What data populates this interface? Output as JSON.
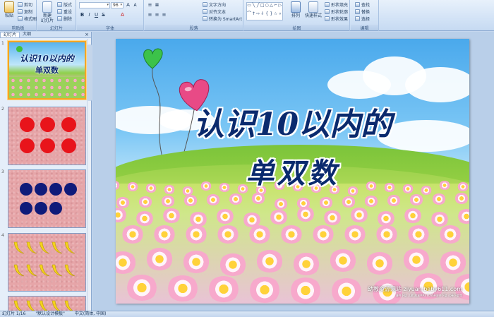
{
  "ribbon": {
    "clipboard": {
      "paste": "粘贴",
      "cut": "剪切",
      "copy": "复制",
      "format_painter": "格式刷",
      "label": "剪贴板"
    },
    "slides": {
      "new_slide": "新建\n幻灯片",
      "layout": "版式",
      "reset": "重设",
      "delete": "删除",
      "label": "幻灯片"
    },
    "font": {
      "font_value": "",
      "size_value": "96",
      "label": "字体"
    },
    "paragraph": {
      "text_direction": "文字方向",
      "align_text": "对齐文本",
      "smartart": "转换为 SmartArt",
      "label": "段落"
    },
    "drawing": {
      "arrange": "排列",
      "quick_styles": "快速样式",
      "fill": "形状填充",
      "outline": "形状轮廓",
      "effects": "形状效果",
      "label": "绘图"
    },
    "editing": {
      "find": "查找",
      "replace": "替换",
      "select": "选择",
      "label": "编辑"
    }
  },
  "left_pane": {
    "tabs": [
      "幻灯片",
      "大纲"
    ],
    "close_glyph": "×",
    "slides": [
      {
        "number": "1",
        "title_line1": "认识10以内的",
        "title_line2": "单双数"
      },
      {
        "number": "2"
      },
      {
        "number": "3"
      },
      {
        "number": "4"
      }
    ]
  },
  "slide": {
    "title_line1": "认识10以内的",
    "title_line2": "单双数",
    "watermark_main": "幼教资源网站 ziyuan.baby611.com",
    "watermark_sub": "课件下载 儿歌 故事MP3 FLASH课件下载 试卷下载等"
  },
  "status": {
    "slide_counter": "幻灯片 1/16",
    "theme": "\"默认设计模板\"",
    "language": "中文(简体, 中国)"
  },
  "colors": {
    "title": "#0a2a6e",
    "red_dot": "#e8141b",
    "blue_dot": "#0f1b7a",
    "banana": "#f4d21c",
    "thumb_bg": "#e6a5a8"
  }
}
